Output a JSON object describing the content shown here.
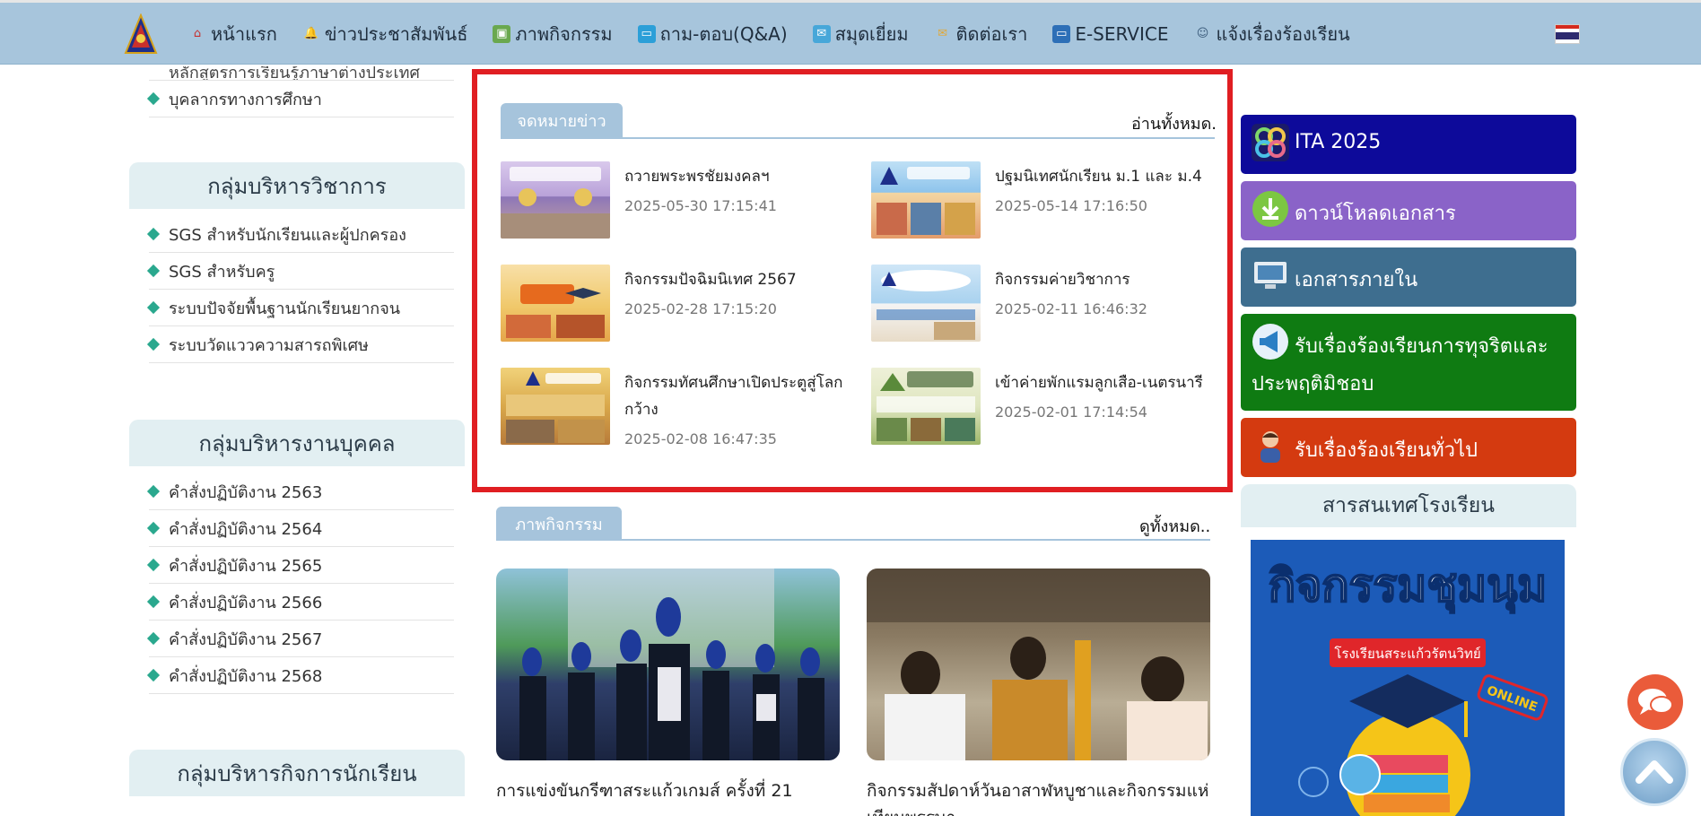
{
  "nav": {
    "items": [
      {
        "label": "หน้าแรก",
        "icon": "home-icon"
      },
      {
        "label": "ข่าวประชาสัมพันธ์",
        "icon": "bell-icon"
      },
      {
        "label": "ภาพกิจกรรม",
        "icon": "picture-icon"
      },
      {
        "label": "ถาม-ตอบ(Q&A)",
        "icon": "chat-icon"
      },
      {
        "label": "สมุดเยี่ยม",
        "icon": "guestbook-icon"
      },
      {
        "label": "ติดต่อเรา",
        "icon": "mail-icon"
      },
      {
        "label": "E-SERVICE",
        "icon": "computer-icon"
      },
      {
        "label": "แจ้งเรื่องร้องเรียน",
        "icon": "person-icon"
      }
    ]
  },
  "left": {
    "top_links": [
      "หลักสูตรการเรียนรู้ภาษาต่างประเทศ",
      "บุคลากรทางการศึกษา"
    ],
    "groups": [
      {
        "title": "กลุ่มบริหารวิชาการ",
        "links": [
          "SGS สำหรับนักเรียนและผู้ปกครอง",
          "SGS สำหรับครู",
          "ระบบปัจจัยพื้นฐานนักเรียนยากจน",
          "ระบบวัดแววความสารถพิเศษ"
        ]
      },
      {
        "title": "กลุ่มบริหารงานบุคคล",
        "links": [
          "คำสั่งปฏิบัติงาน 2563",
          "คำสั่งปฏิบัติงาน 2564",
          "คำสั่งปฏิบัติงาน 2565",
          "คำสั่งปฏิบัติงาน 2566",
          "คำสั่งปฏิบัติงาน 2567",
          "คำสั่งปฏิบัติงาน 2568"
        ]
      },
      {
        "title": "กลุ่มบริหารกิจการนักเรียน",
        "links": []
      }
    ]
  },
  "news": {
    "tab": "จดหมายข่าว",
    "more": "อ่านทั้งหมด.",
    "items": [
      {
        "title": "ถวายพระพรชัยมงคลฯ",
        "date": "2025-05-30 17:15:41"
      },
      {
        "title": "ปฐมนิเทศนักเรียน ม.1 และ ม.4",
        "date": "2025-05-14 17:16:50"
      },
      {
        "title": "กิจกรรมปัจฉิมนิเทศ 2567",
        "date": "2025-02-28 17:15:20"
      },
      {
        "title": "กิจกรรมค่ายวิชาการ",
        "date": "2025-02-11 16:46:32"
      },
      {
        "title": "กิจกรรมทัศนศึกษาเปิดประตูสู่โลกกว้าง",
        "date": "2025-02-08 16:47:35"
      },
      {
        "title": "เข้าค่ายพักแรมลูกเสือ-เนตรนารี",
        "date": "2025-02-01 17:14:54"
      }
    ]
  },
  "gallery": {
    "tab": "ภาพกิจกรรม",
    "more": "ดูทั้งหมด..",
    "items": [
      {
        "caption": "การแข่งขันกรีฑาสระแก้วเกมส์ ครั้งที่ 21"
      },
      {
        "caption": "กิจกรรมสัปดาห์วันอาสาฬหบูชาและกิจกรรมแห่เทียนพรรษา"
      }
    ]
  },
  "right": {
    "buttons": [
      {
        "label": "ITA 2025",
        "color": "#0d0a9a",
        "icon": "ita-logo-icon"
      },
      {
        "label": "ดาวน์โหลดเอกสาร",
        "color": "#8a63c8",
        "icon": "download-icon"
      },
      {
        "label": "เอกสารภายใน",
        "color": "#3e6e8f",
        "icon": "monitor-icon"
      },
      {
        "label": "รับเรื่องร้องเรียนการทุจริตและประพฤติมิชอบ",
        "color": "#0f7b12",
        "icon": "megaphone-icon"
      },
      {
        "label": "รับเรื่องร้องเรียนทั่วไป",
        "color": "#d43a10",
        "icon": "person-icon"
      }
    ],
    "info_title": "สารสนเทศโรงเรียน",
    "poster": {
      "title": "กิจกรรมชุมนุม",
      "subtitle": "โรงเรียนสระแก้วรัตนวิทย์",
      "tag": "ONLINE"
    }
  }
}
